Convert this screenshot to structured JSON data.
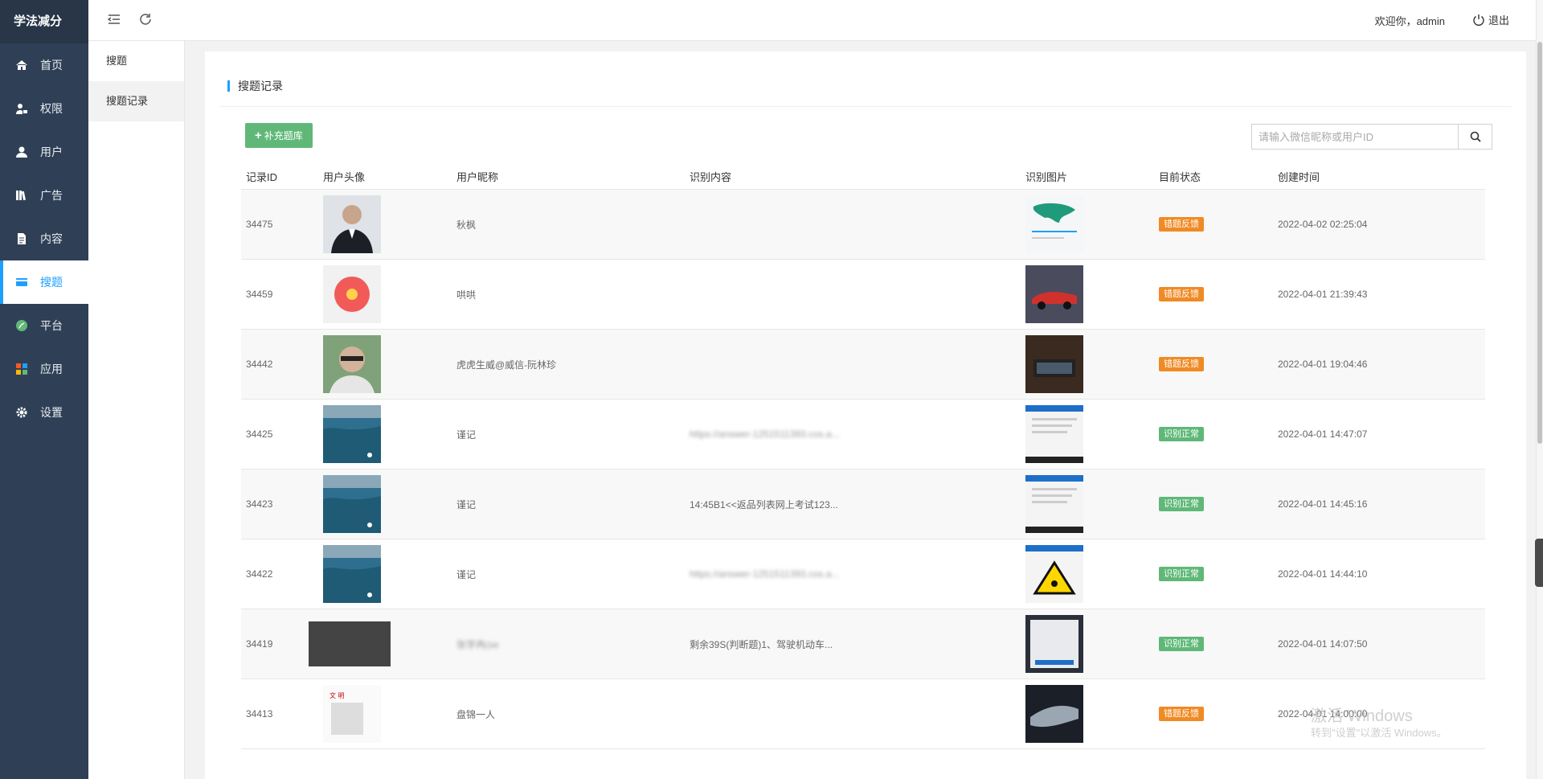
{
  "brand": "学法减分",
  "nav": [
    {
      "label": "首页",
      "icon": "home-icon"
    },
    {
      "label": "权限",
      "icon": "user-lock-icon"
    },
    {
      "label": "用户",
      "icon": "user-icon"
    },
    {
      "label": "广告",
      "icon": "books-icon"
    },
    {
      "label": "内容",
      "icon": "document-icon"
    },
    {
      "label": "搜题",
      "icon": "card-icon",
      "active": true
    },
    {
      "label": "平台",
      "icon": "leaf-icon"
    },
    {
      "label": "应用",
      "icon": "apps-icon"
    },
    {
      "label": "设置",
      "icon": "gear-icon"
    }
  ],
  "subnav": [
    "搜题",
    "搜题记录"
  ],
  "header": {
    "welcome": "欢迎你，admin",
    "logout": "退出"
  },
  "card": {
    "title": "搜题记录"
  },
  "toolbar": {
    "add_label": "补充题库",
    "search_placeholder": "请输入微信昵称或用户ID"
  },
  "table": {
    "columns": [
      "记录ID",
      "用户头像",
      "用户昵称",
      "识别内容",
      "识别图片",
      "目前状态",
      "创建时间"
    ],
    "rows": [
      {
        "id": "34475",
        "nick": "秋枫",
        "content": "",
        "status": "错题反馈",
        "status_type": "err",
        "time": "2022-04-02 02:25:04"
      },
      {
        "id": "34459",
        "nick": "哄哄",
        "content": "",
        "status": "错题反馈",
        "status_type": "err",
        "time": "2022-04-01 21:39:43"
      },
      {
        "id": "34442",
        "nick": "虎虎生威@威信-阮林珍",
        "content": "",
        "status": "错题反馈",
        "status_type": "err",
        "time": "2022-04-01 19:04:46"
      },
      {
        "id": "34425",
        "nick": "谨记",
        "content": "https://answer-1251511393.cos.a...",
        "status": "识别正常",
        "status_type": "ok",
        "time": "2022-04-01 14:47:07"
      },
      {
        "id": "34423",
        "nick": "谨记",
        "content": "14:45B1<<返品列表网上考试123...",
        "status": "识别正常",
        "status_type": "ok",
        "time": "2022-04-01 14:45:16"
      },
      {
        "id": "34422",
        "nick": "谨记",
        "content": "https://answer-1251511393.cos.a...",
        "status": "识别正常",
        "status_type": "ok",
        "time": "2022-04-01 14:44:10"
      },
      {
        "id": "34419",
        "nick": "张学冉(se",
        "content": "剩余39S(判断题)1、驾驶机动车...",
        "status": "识别正常",
        "status_type": "ok",
        "time": "2022-04-01 14:07:50"
      },
      {
        "id": "34413",
        "nick": "盘锦一人",
        "content": "",
        "status": "错题反馈",
        "status_type": "err",
        "time": "2022-04-01 14:00:00"
      }
    ]
  },
  "watermark": {
    "line1": "激活 Windows",
    "line2": "转到\"设置\"以激活 Windows。"
  }
}
